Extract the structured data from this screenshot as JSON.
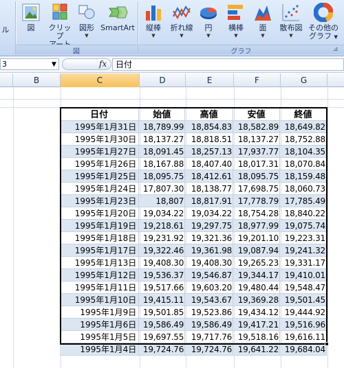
{
  "ribbon": {
    "partial_left_label": "ル",
    "insert_group": {
      "label": "図",
      "buttons": [
        {
          "name": "picture-button",
          "label": "図",
          "icon": "picture-icon"
        },
        {
          "name": "clipart-button",
          "label": "クリップ アート",
          "label1": "クリップ",
          "label2": "アート",
          "icon": "clipart-icon"
        },
        {
          "name": "shapes-button",
          "label": "図形",
          "icon": "shapes-icon"
        },
        {
          "name": "smartart-button",
          "label": "SmartArt",
          "icon": "smartart-icon"
        }
      ]
    },
    "chart_group": {
      "label": "グラフ",
      "buttons": [
        {
          "name": "column-chart-button",
          "label": "縦棒",
          "icon": "column-chart-icon"
        },
        {
          "name": "line-chart-button",
          "label": "折れ線",
          "icon": "line-chart-icon"
        },
        {
          "name": "pie-chart-button",
          "label": "円",
          "icon": "pie-chart-icon"
        },
        {
          "name": "bar-chart-button",
          "label": "横棒",
          "icon": "bar-chart-icon"
        },
        {
          "name": "area-chart-button",
          "label": "面",
          "icon": "area-chart-icon"
        },
        {
          "name": "scatter-chart-button",
          "label": "散布図",
          "icon": "scatter-chart-icon"
        },
        {
          "name": "other-charts-button",
          "label1": "その他の",
          "label2": "グラフ",
          "icon": "donut-chart-icon"
        }
      ]
    }
  },
  "formula_bar": {
    "name_box": "3",
    "fx": "fx",
    "content": "日付"
  },
  "columns": [
    "B",
    "C",
    "D",
    "E",
    "F",
    "G"
  ],
  "selected_column": "C",
  "table": {
    "headers": [
      "日付",
      "始値",
      "高値",
      "安値",
      "終値"
    ],
    "rows": [
      [
        "1995年1月31日",
        "18,789.99",
        "18,854.83",
        "18,582.89",
        "18,649.82"
      ],
      [
        "1995年1月30日",
        "18,137.27",
        "18,818.51",
        "18,137.27",
        "18,752.88"
      ],
      [
        "1995年1月27日",
        "18,091.45",
        "18,257.13",
        "17,937.77",
        "18,104.35"
      ],
      [
        "1995年1月26日",
        "18,167.88",
        "18,407.40",
        "18,017.31",
        "18,070.84"
      ],
      [
        "1995年1月25日",
        "18,095.75",
        "18,412.61",
        "18,095.75",
        "18,159.48"
      ],
      [
        "1995年1月24日",
        "17,807.30",
        "18,138.77",
        "17,698.75",
        "18,060.73"
      ],
      [
        "1995年1月23日",
        "18,807",
        "18,817.91",
        "17,778.79",
        "17,785.49"
      ],
      [
        "1995年1月20日",
        "19,034.22",
        "19,034.22",
        "18,754.28",
        "18,840.22"
      ],
      [
        "1995年1月19日",
        "19,218.61",
        "19,297.75",
        "18,977.99",
        "19,075.74"
      ],
      [
        "1995年1月18日",
        "19,231.92",
        "19,321.36",
        "19,201.10",
        "19,223.31"
      ],
      [
        "1995年1月17日",
        "19,322.46",
        "19,361.98",
        "19,087.94",
        "19,241.32"
      ],
      [
        "1995年1月13日",
        "19,408.30",
        "19,408.30",
        "19,265.23",
        "19,331.17"
      ],
      [
        "1995年1月12日",
        "19,536.37",
        "19,546.87",
        "19,344.17",
        "19,410.01"
      ],
      [
        "1995年1月11日",
        "19,517.66",
        "19,603.20",
        "19,480.44",
        "19,548.47"
      ],
      [
        "1995年1月10日",
        "19,415.11",
        "19,543.67",
        "19,369.28",
        "19,501.45"
      ],
      [
        "1995年1月9日",
        "19,501.85",
        "19,523.86",
        "19,434.12",
        "19,444.92"
      ],
      [
        "1995年1月6日",
        "19,586.49",
        "19,586.49",
        "19,417.21",
        "19,516.96"
      ],
      [
        "1995年1月5日",
        "19,697.55",
        "19,717.76",
        "19,518.16",
        "19,616.11"
      ],
      [
        "1995年1月4日",
        "19,724.76",
        "19,724.76",
        "19,641.22",
        "19,684.04"
      ]
    ]
  },
  "colors": {
    "ribbon_bg": "#d3e2f7",
    "selected_column": "#f7c15d",
    "table_shading": "#dce6f2",
    "grid_line": "#d4dce8"
  }
}
